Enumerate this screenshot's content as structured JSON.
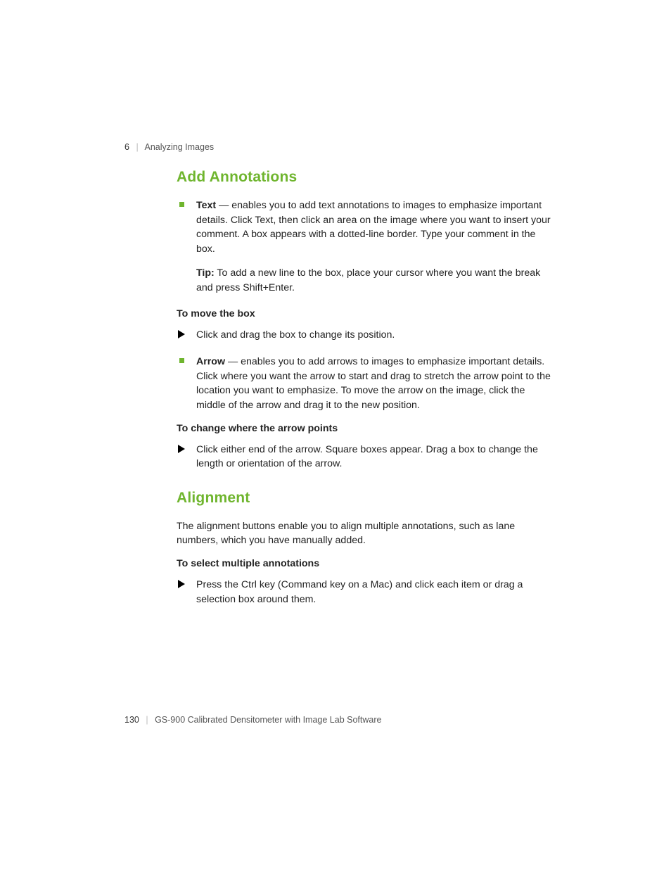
{
  "runhead": {
    "chapter_num": "6",
    "chapter_title": "Analyzing Images",
    "sep": "|"
  },
  "sections": {
    "add_annotations": {
      "heading": "Add Annotations",
      "text_bullet": {
        "lead": "Text",
        "body": " — enables you to add text annotations to images to emphasize important details. Click Text, then click an area on the image where you want to insert your comment. A box appears with a dotted-line border. Type your comment in the box."
      },
      "tip": {
        "label": "Tip:",
        "body": "  To add a new line to the box, place your cursor where you want the break and press Shift+Enter."
      },
      "move_box": {
        "heading": "To move the box",
        "step": "Click and drag the box to change its position."
      },
      "arrow_bullet": {
        "lead": "Arrow",
        "body": " — enables you to add arrows to images to emphasize important details. Click where you want the arrow to start and drag to stretch the arrow point to the location you want to emphasize. To move the arrow on the image, click the middle of the arrow and drag it to the new position."
      },
      "change_arrow": {
        "heading": "To change where the arrow points",
        "step": "Click either end of the arrow. Square boxes appear. Drag a box to change the length or orientation of the arrow."
      }
    },
    "alignment": {
      "heading": "Alignment",
      "intro": "The alignment buttons enable you to align multiple annotations, such as lane numbers, which you have manually added.",
      "select_multi": {
        "heading": "To select multiple annotations",
        "step": "Press the Ctrl key (Command key on a Mac) and click each item or drag a selection box around them."
      }
    }
  },
  "footer": {
    "page_num": "130",
    "sep": "|",
    "doc_title": "GS-900 Calibrated Densitometer with Image Lab Software"
  }
}
